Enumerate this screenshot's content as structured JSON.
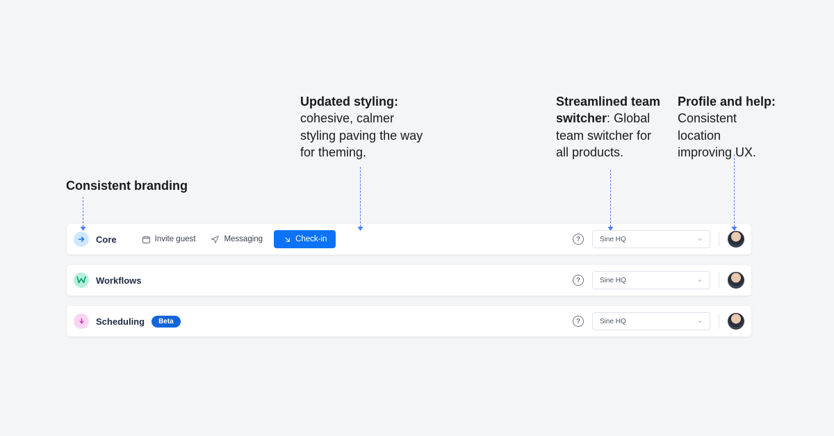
{
  "annotations": {
    "branding": {
      "title": "Consistent branding"
    },
    "styling": {
      "title": "Updated styling:",
      "body": "cohesive, calmer styling paving the way for theming."
    },
    "switcher": {
      "title": "Streamlined team switcher",
      "body": "Global team switcher for all products."
    },
    "profile": {
      "title": "Profile and help:",
      "body": "Consistent location improving UX."
    }
  },
  "common": {
    "team": "Sine HQ"
  },
  "navbars": {
    "core": {
      "label": "Core",
      "invite": "Invite guest",
      "messaging": "Messaging",
      "checkin": "Check-in"
    },
    "workflows": {
      "label": "Workflows"
    },
    "scheduling": {
      "label": "Scheduling",
      "beta": "Beta"
    }
  }
}
